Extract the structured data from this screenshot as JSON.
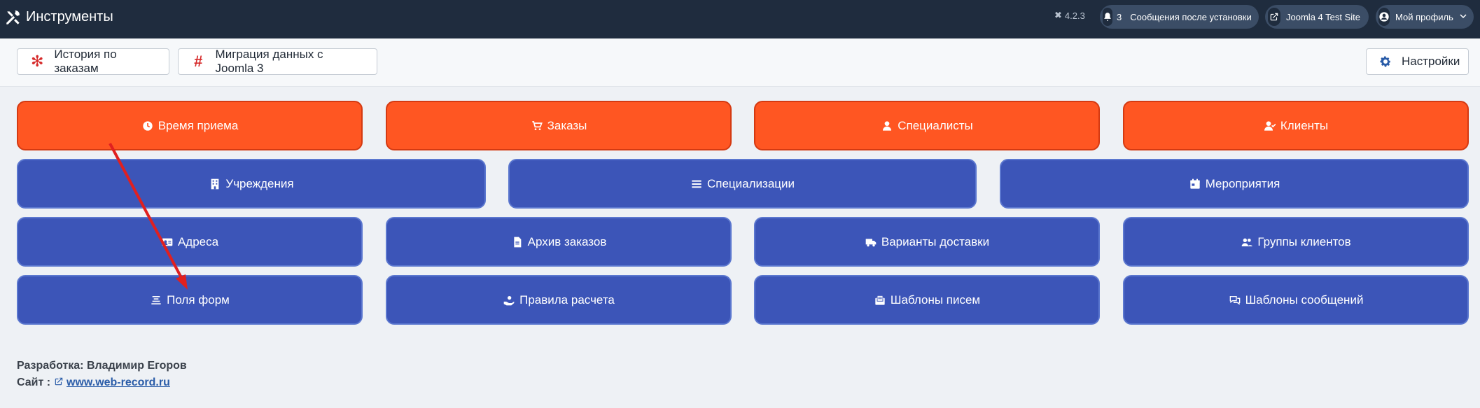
{
  "header": {
    "title": "Инструменты",
    "version": "4.2.3",
    "notifications_count": "3",
    "notifications_label": "Сообщения после установки",
    "site_label": "Joomla 4 Test Site",
    "profile_label": "Мой профиль"
  },
  "toolbar": {
    "history_label": "История по заказам",
    "migration_label": "Миграция данных с Joomla 3",
    "settings_label": "Настройки"
  },
  "tiles": {
    "row1": [
      "Время приема",
      "Заказы",
      "Специалисты",
      "Клиенты"
    ],
    "row2": [
      "Учреждения",
      "Специализации",
      "Мероприятия"
    ],
    "row3": [
      "Адреса",
      "Архив заказов",
      "Варианты доставки",
      "Группы клиентов"
    ],
    "row4": [
      "Поля форм",
      "Правила расчета",
      "Шаблоны писем",
      "Шаблоны сообщений"
    ]
  },
  "footer": {
    "developer_prefix": "Разработка: ",
    "developer_name": "Владимир Егоров",
    "site_prefix": "Сайт : ",
    "site_link": "www.web-record.ru"
  },
  "colors": {
    "header_bg": "#1f2c3e",
    "orange": "#ff5622",
    "blue": "#3c55b8",
    "arrow": "#e02020"
  }
}
